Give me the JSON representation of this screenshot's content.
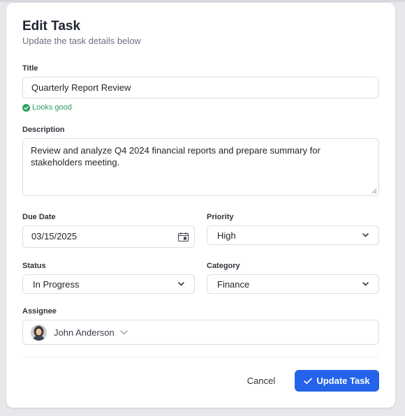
{
  "form": {
    "title": "Edit Task",
    "subtitle": "Update the task details below"
  },
  "fields": {
    "title_label": "Title",
    "title_value": "Quarterly Report Review",
    "title_validation": "Looks good",
    "description_label": "Description",
    "description_value": "Review and analyze Q4 2024 financial reports and prepare summary for stakeholders meeting.",
    "due_date_label": "Due Date",
    "due_date_value": "03/15/2025",
    "priority_label": "Priority",
    "priority_value": "High",
    "status_label": "Status",
    "status_value": "In Progress",
    "category_label": "Category",
    "category_value": "Finance",
    "assignee_label": "Assignee",
    "assignee_value": "John Anderson"
  },
  "actions": {
    "cancel_label": "Cancel",
    "submit_label": "Update Task"
  },
  "colors": {
    "primary": "#2563eb",
    "success": "#2f9e62",
    "page_background": "#e7e8eb"
  },
  "icons": {
    "validation": "check-circle-icon",
    "calendar": "calendar-icon",
    "dropdown": "chevron-down-icon",
    "submit": "check-icon"
  }
}
